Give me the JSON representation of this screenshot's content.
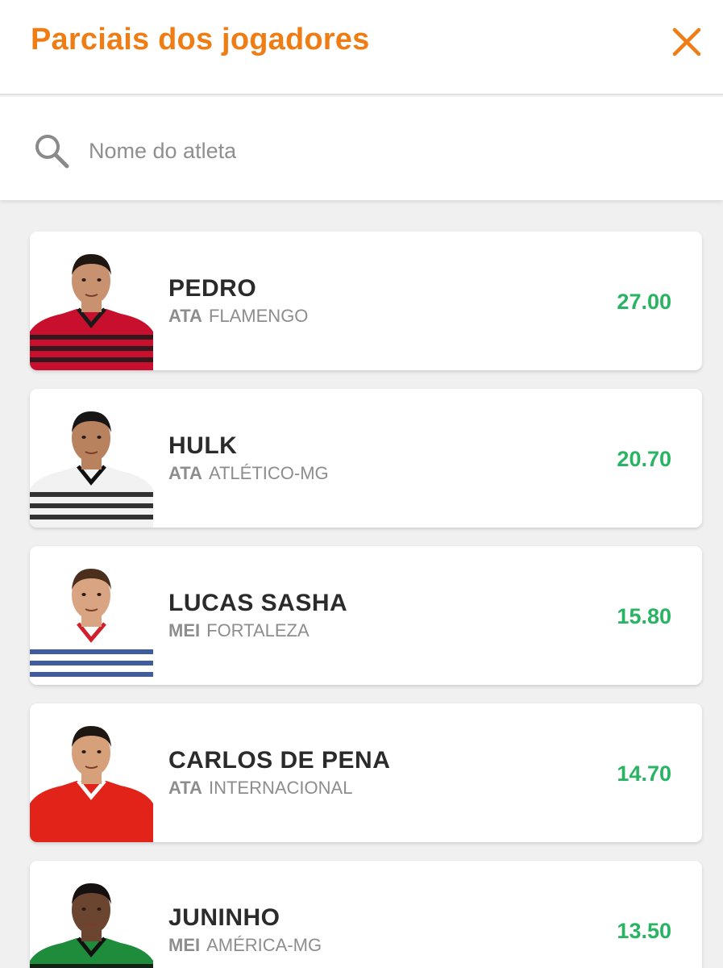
{
  "header": {
    "title": "Parciais dos jogadores",
    "close_icon": "close-icon"
  },
  "search": {
    "placeholder": "Nome do atleta",
    "value": "",
    "icon": "search-icon"
  },
  "colors": {
    "accent": "#f07c14",
    "points": "#28b463",
    "background": "#f0f0f1"
  },
  "players": [
    {
      "name": "PEDRO",
      "position": "ATA",
      "club": "FLAMENGO",
      "points": "27.00",
      "jersey": {
        "base": "#c8102e",
        "stripe": "#1a1a1a",
        "collar": "#1a1a1a",
        "skin": "#c89170",
        "hair": "#1f1611"
      }
    },
    {
      "name": "HULK",
      "position": "ATA",
      "club": "ATLÉTICO-MG",
      "points": "20.70",
      "jersey": {
        "base": "#f2f2f2",
        "stripe": "#111111",
        "collar": "#111111",
        "skin": "#b9825f",
        "hair": "#161616"
      }
    },
    {
      "name": "LUCAS SASHA",
      "position": "MEI",
      "club": "FORTALEZA",
      "points": "15.80",
      "jersey": {
        "base": "#ffffff",
        "stripe": "#1f3f8f",
        "collar": "#d0202c",
        "skin": "#d9a481",
        "hair": "#4a2f1d"
      }
    },
    {
      "name": "CARLOS DE PENA",
      "position": "ATA",
      "club": "INTERNACIONAL",
      "points": "14.70",
      "jersey": {
        "base": "#e2231a",
        "stripe": "#e2231a",
        "collar": "#ffffff",
        "skin": "#d6a07b",
        "hair": "#1d1611"
      }
    },
    {
      "name": "JUNINHO",
      "position": "MEI",
      "club": "AMÉRICA-MG",
      "points": "13.50",
      "jersey": {
        "base": "#1e8c3a",
        "stripe": "#111111",
        "collar": "#111111",
        "skin": "#6b4530",
        "hair": "#161010"
      }
    }
  ]
}
